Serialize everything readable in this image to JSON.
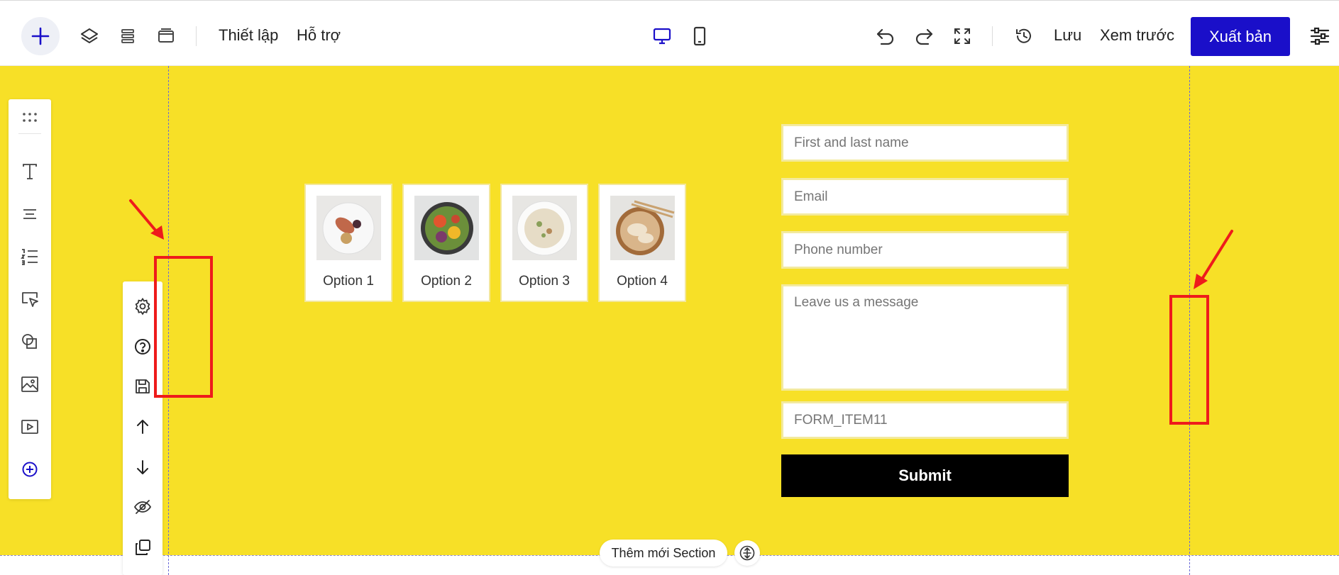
{
  "toolbar": {
    "menu_setup": "Thiết lập",
    "menu_support": "Hỗ trợ",
    "save_label": "Lưu",
    "preview_label": "Xem trước",
    "publish_label": "Xuất bản",
    "icons": [
      "plus-icon",
      "layers-icon",
      "stack-icon",
      "pages-icon",
      "desktop-icon",
      "mobile-icon",
      "undo-icon",
      "redo-icon",
      "fullscreen-icon",
      "history-icon",
      "settings-sliders-icon"
    ],
    "accent_color": "#1a0fc9"
  },
  "left_toolbar": {
    "icons": [
      "drag-handle-icon",
      "text-icon",
      "paragraph-icon",
      "list-icon",
      "button-cursor-icon",
      "shapes-icon",
      "image-icon",
      "video-icon",
      "add-circle-icon"
    ]
  },
  "section_toolbar": {
    "icons": [
      "gear-icon",
      "help-icon",
      "save-icon",
      "arrow-up-icon",
      "arrow-down-icon",
      "eye-off-icon",
      "duplicate-icon"
    ]
  },
  "canvas": {
    "background_color": "#f7e027"
  },
  "options": [
    {
      "label": "Option 1",
      "image": "plate-with-shrimp-dish"
    },
    {
      "label": "Option 2",
      "image": "salad-bowl"
    },
    {
      "label": "Option 3",
      "image": "soup-bowl"
    },
    {
      "label": "Option 4",
      "image": "dumplings-with-chopsticks"
    }
  ],
  "form": {
    "name_placeholder": "First and last name",
    "email_placeholder": "Email",
    "phone_placeholder": "Phone number",
    "message_placeholder": "Leave us a message",
    "extra_field": "FORM_ITEM11",
    "submit_label": "Submit"
  },
  "footer": {
    "add_section_label": "Thêm mới Section"
  },
  "annotation_color": "#ee1b1b"
}
